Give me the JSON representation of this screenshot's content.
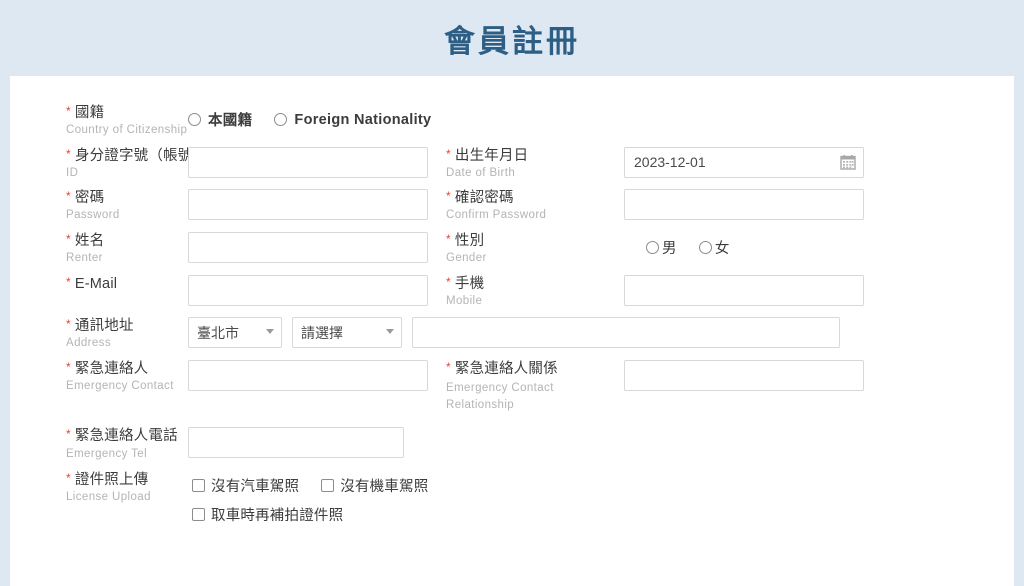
{
  "header": {
    "title": "會員註冊"
  },
  "form": {
    "nationality": {
      "label_zh": "國籍",
      "label_en": "Country of Citizenship",
      "options": [
        {
          "label": "本國籍",
          "selected": false
        },
        {
          "label": "Foreign Nationality",
          "selected": false
        }
      ]
    },
    "id": {
      "label_zh": "身分證字號（帳號）",
      "label_en": "ID",
      "value": "",
      "placeholder": ""
    },
    "birth": {
      "label_zh": "出生年月日",
      "label_en": "Date of Birth",
      "value": "2023-12-01",
      "icon": "calendar-icon"
    },
    "password": {
      "label_zh": "密碼",
      "label_en": "Password",
      "value": ""
    },
    "confirm_password": {
      "label_zh": "確認密碼",
      "label_en": "Confirm Password",
      "value": ""
    },
    "name": {
      "label_zh": "姓名",
      "label_en": "Renter",
      "value": ""
    },
    "gender": {
      "label_zh": "性別",
      "label_en": "Gender",
      "options": [
        {
          "label": "男",
          "selected": false
        },
        {
          "label": "女",
          "selected": false
        }
      ]
    },
    "email": {
      "label_zh": "E-Mail",
      "label_en": "",
      "value": ""
    },
    "mobile": {
      "label_zh": "手機",
      "label_en": "Mobile",
      "value": ""
    },
    "address": {
      "label_zh": "通訊地址",
      "label_en": "Address",
      "city": "臺北市",
      "district": "請選擇",
      "detail": ""
    },
    "emergency_contact": {
      "label_zh": "緊急連絡人",
      "label_en": "Emergency Contact",
      "value": ""
    },
    "emergency_relationship": {
      "label_zh": "緊急連絡人關係",
      "label_en": "Emergency Contact Relationship",
      "value": ""
    },
    "emergency_tel": {
      "label_zh": "緊急連絡人電話",
      "label_en": "Emergency Tel",
      "value": ""
    },
    "license_upload": {
      "label_zh": "證件照上傳",
      "label_en": "License Upload",
      "options": [
        {
          "label": "沒有汽車駕照",
          "checked": false
        },
        {
          "label": "沒有機車駕照",
          "checked": false
        },
        {
          "label": "取車時再補拍證件照",
          "checked": false
        }
      ]
    }
  },
  "colors": {
    "header_bg": "#dde8f3",
    "title": "#2d5f86",
    "required_star": "#e8452c",
    "label": "#3c3c3c",
    "sub_label": "#b4b4b4",
    "input_border": "#d8d8d8"
  }
}
